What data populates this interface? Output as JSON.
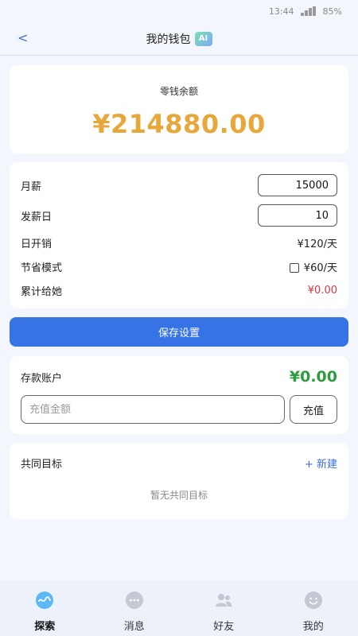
{
  "status_bar": {
    "time": "13:44",
    "battery": "85%"
  },
  "header": {
    "back": "<",
    "title": "我的钱包",
    "badge": "AI"
  },
  "balance": {
    "label": "零钱余额",
    "value": "¥214880.00"
  },
  "settings": {
    "salary_label": "月薪",
    "salary_value": "15000",
    "payday_label": "发薪日",
    "payday_value": "10",
    "daily_cost_label": "日开销",
    "daily_cost_value": "¥120/天",
    "saving_mode_label": "节省模式",
    "saving_mode_value": "¥60/天",
    "saving_mode_checked": false,
    "total_given_label": "累计给她",
    "total_given_value": "¥0.00"
  },
  "save_button": "保存设置",
  "deposit": {
    "label": "存款账户",
    "value": "¥0.00",
    "amount_placeholder": "充值金额",
    "charge_button": "充值"
  },
  "goals": {
    "title": "共同目标",
    "new_button": "+ 新建",
    "empty_text": "暂无共同目标"
  },
  "tabbar": {
    "tabs": [
      {
        "label": "探索",
        "icon": "explore-icon",
        "active": true
      },
      {
        "label": "消息",
        "icon": "message-icon",
        "active": false
      },
      {
        "label": "好友",
        "icon": "friends-icon",
        "active": false
      },
      {
        "label": "我的",
        "icon": "profile-icon",
        "active": false
      }
    ]
  },
  "colors": {
    "accent": "#3673e4",
    "balance": "#e8a73a",
    "deposit": "#2c9c3f",
    "danger": "#d9363e",
    "active_tab_icon": "#5bb8f5",
    "inactive_tab_icon": "#c4c8d2"
  }
}
